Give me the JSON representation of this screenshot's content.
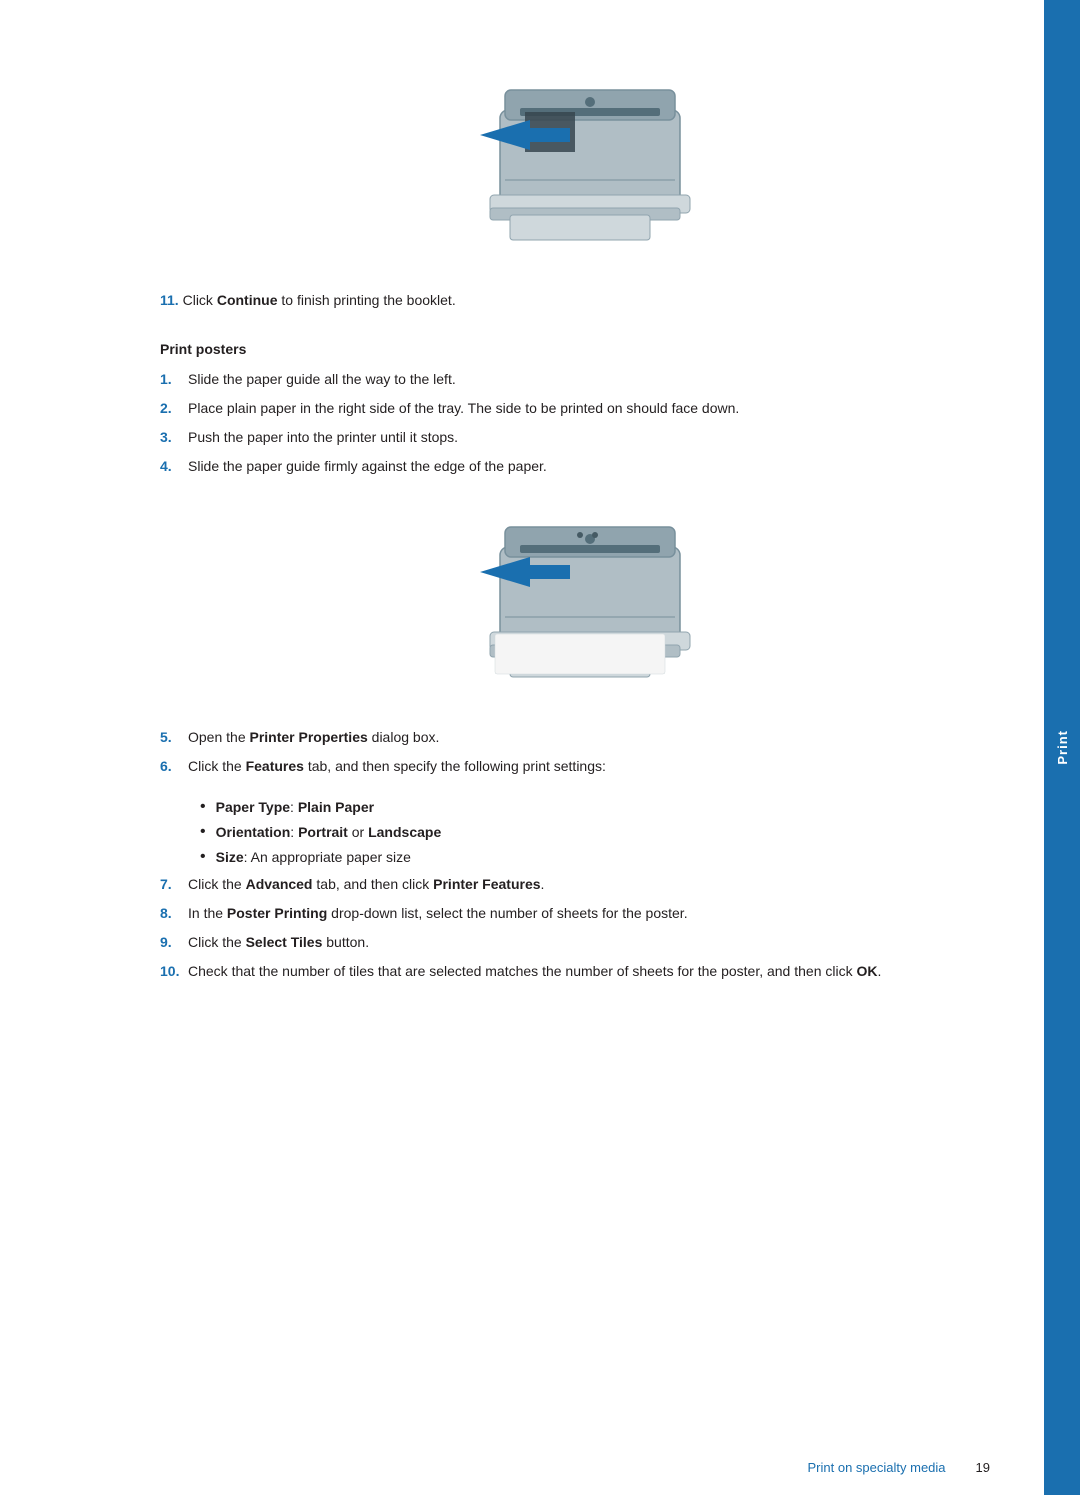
{
  "side_tab": {
    "label": "Print"
  },
  "step_11": {
    "number": "11.",
    "text_before": "Click ",
    "bold_word": "Continue",
    "text_after": " to finish printing the booklet."
  },
  "section_heading": "Print posters",
  "steps_1_4": [
    {
      "num": "1.",
      "text": "Slide the paper guide all the way to the left."
    },
    {
      "num": "2.",
      "text": "Place plain paper in the right side of the tray. The side to be printed on should face down."
    },
    {
      "num": "3.",
      "text": "Push the paper into the printer until it stops."
    },
    {
      "num": "4.",
      "text": "Slide the paper guide firmly against the edge of the paper."
    }
  ],
  "steps_5_10": [
    {
      "num": "5.",
      "text_before": "Open the ",
      "bold": "Printer Properties",
      "text_after": " dialog box."
    },
    {
      "num": "6.",
      "text_before": "Click the ",
      "bold": "Features",
      "text_after": " tab, and then specify the following print settings:"
    },
    {
      "num": "7.",
      "text_before": "Click the ",
      "bold": "Advanced",
      "text_after_1": " tab, and then click ",
      "bold2": "Printer Features",
      "text_after_2": "."
    },
    {
      "num": "8.",
      "text_before": "In the ",
      "bold": "Poster Printing",
      "text_after": " drop-down list, select the number of sheets for the poster."
    },
    {
      "num": "9.",
      "text_before": "Click the ",
      "bold": "Select Tiles",
      "text_after": " button."
    },
    {
      "num": "10.",
      "text_before": "Check that the number of tiles that are selected matches the number of sheets for the poster, and then click ",
      "bold": "OK",
      "text_after": "."
    }
  ],
  "bullet_items": [
    {
      "bold": "Paper Type",
      "separator": ": ",
      "bold2": "Plain Paper"
    },
    {
      "bold": "Orientation",
      "separator": ": ",
      "bold2": "Portrait",
      "text_between": " or ",
      "bold3": "Landscape"
    },
    {
      "bold": "Size",
      "separator": ": ",
      "text": "An appropriate paper size"
    }
  ],
  "footer": {
    "link_text": "Print on specialty media",
    "page_number": "19"
  }
}
